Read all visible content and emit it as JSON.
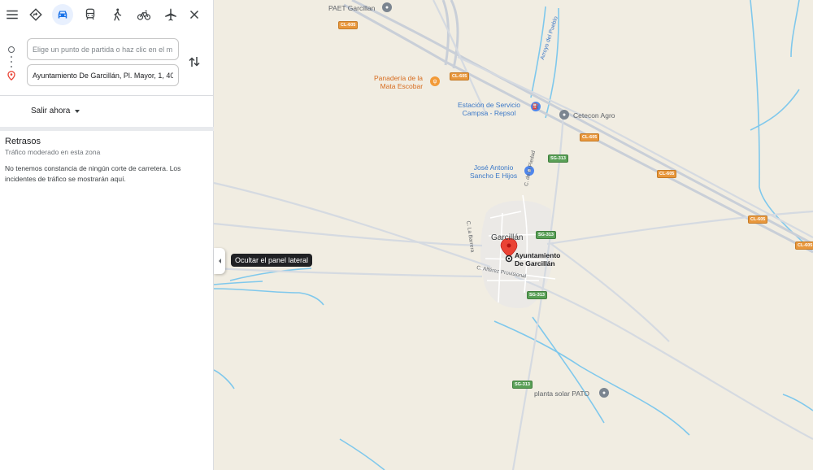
{
  "modes": [
    {
      "name": "menu-icon",
      "label": "Menú"
    },
    {
      "name": "best-route-icon",
      "label": "Mejor medio de transporte"
    },
    {
      "name": "car-icon",
      "label": "En coche",
      "active": true
    },
    {
      "name": "transit-icon",
      "label": "Transporte público"
    },
    {
      "name": "walk-icon",
      "label": "A pie"
    },
    {
      "name": "bike-icon",
      "label": "En bicicleta"
    },
    {
      "name": "flight-icon",
      "label": "En avión"
    },
    {
      "name": "close-icon",
      "label": "Cerrar indicaciones"
    }
  ],
  "route": {
    "start_placeholder": "Elige un punto de partida o haz clic en el m",
    "start_value": "",
    "end_value": "Ayuntamiento De Garcillán, Pl. Mayor, 1, 40"
  },
  "depart": {
    "label": "Salir ahora"
  },
  "delays": {
    "title": "Retrasos",
    "subtitle": "Tráfico moderado en esta zona",
    "body": "No tenemos constancia de ningún corte de carretera. Los incidentes de tráfico se mostrarán aquí."
  },
  "collapse": {
    "tooltip": "Ocultar el panel lateral"
  },
  "map": {
    "places": {
      "paet": "PAET Garcillan",
      "bakery_l1": "Panadería de la",
      "bakery_l2": "Mata Escobar",
      "station_l1": "Estación de Servicio",
      "station_l2": "Campsa - Repsol",
      "cetecon": "Cetecon Agro",
      "jose_l1": "José Antonio",
      "jose_l2": "Sancho E Hijos",
      "town": "Garcillán",
      "target_l1": "Ayuntamiento",
      "target_l2": "De Garcillán",
      "solar": "planta solar PATO"
    },
    "streets": {
      "piedad": "C. de la Piedad",
      "barrera": "C. La Barrera",
      "alferez": "C. Alférez Provisional",
      "arroyo": "Arroyo del Pueblo"
    },
    "shields": {
      "cl605": "CL-605",
      "sg313": "SG-313"
    },
    "colors": {
      "land": "#f1ede2",
      "water": "#7fc8ec",
      "highway": "#c9cfd8",
      "road": "#d5dae1",
      "town": "#ebe9e6",
      "pin": "#ea4335",
      "accent": "#1a73e8"
    }
  }
}
